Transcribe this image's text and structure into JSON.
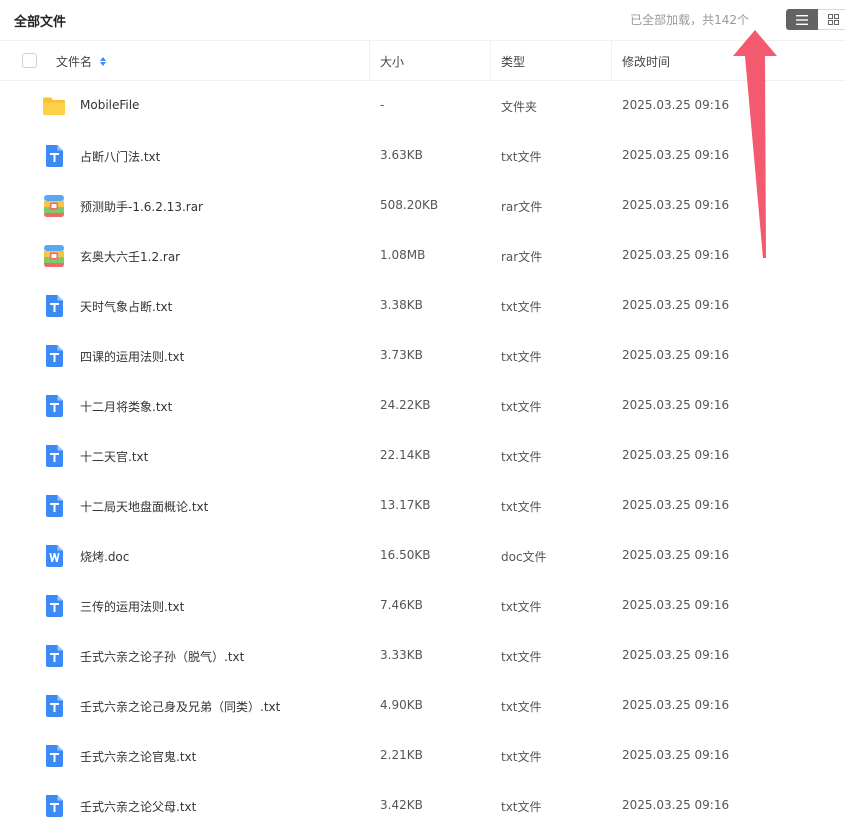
{
  "header": {
    "title": "全部文件",
    "load_status": "已全部加载，共142个"
  },
  "columns": {
    "name": "文件名",
    "size": "大小",
    "type": "类型",
    "modified": "修改时间"
  },
  "colors": {
    "accent": "#3b8af5",
    "folder": "#f9c12f",
    "annotation_arrow": "#f45a6e"
  },
  "files": [
    {
      "name": "MobileFile",
      "size": "-",
      "type": "文件夹",
      "modified": "2025.03.25 09:16",
      "icon": "folder-icon"
    },
    {
      "name": "占断八门法.txt",
      "size": "3.63KB",
      "type": "txt文件",
      "modified": "2025.03.25 09:16",
      "icon": "txt-file-icon"
    },
    {
      "name": "预测助手-1.6.2.13.rar",
      "size": "508.20KB",
      "type": "rar文件",
      "modified": "2025.03.25 09:16",
      "icon": "rar-file-icon"
    },
    {
      "name": "玄奥大六壬1.2.rar",
      "size": "1.08MB",
      "type": "rar文件",
      "modified": "2025.03.25 09:16",
      "icon": "rar-file-icon"
    },
    {
      "name": "天时气象占断.txt",
      "size": "3.38KB",
      "type": "txt文件",
      "modified": "2025.03.25 09:16",
      "icon": "txt-file-icon"
    },
    {
      "name": "四课的运用法则.txt",
      "size": "3.73KB",
      "type": "txt文件",
      "modified": "2025.03.25 09:16",
      "icon": "txt-file-icon"
    },
    {
      "name": "十二月将类象.txt",
      "size": "24.22KB",
      "type": "txt文件",
      "modified": "2025.03.25 09:16",
      "icon": "txt-file-icon"
    },
    {
      "name": "十二天官.txt",
      "size": "22.14KB",
      "type": "txt文件",
      "modified": "2025.03.25 09:16",
      "icon": "txt-file-icon"
    },
    {
      "name": "十二局天地盘面概论.txt",
      "size": "13.17KB",
      "type": "txt文件",
      "modified": "2025.03.25 09:16",
      "icon": "txt-file-icon"
    },
    {
      "name": "烧烤.doc",
      "size": "16.50KB",
      "type": "doc文件",
      "modified": "2025.03.25 09:16",
      "icon": "doc-file-icon"
    },
    {
      "name": "三传的运用法则.txt",
      "size": "7.46KB",
      "type": "txt文件",
      "modified": "2025.03.25 09:16",
      "icon": "txt-file-icon"
    },
    {
      "name": "壬式六亲之论子孙（脱气）.txt",
      "size": "3.33KB",
      "type": "txt文件",
      "modified": "2025.03.25 09:16",
      "icon": "txt-file-icon"
    },
    {
      "name": "壬式六亲之论己身及兄弟（同类）.txt",
      "size": "4.90KB",
      "type": "txt文件",
      "modified": "2025.03.25 09:16",
      "icon": "txt-file-icon"
    },
    {
      "name": "壬式六亲之论官鬼.txt",
      "size": "2.21KB",
      "type": "txt文件",
      "modified": "2025.03.25 09:16",
      "icon": "txt-file-icon"
    },
    {
      "name": "壬式六亲之论父母.txt",
      "size": "3.42KB",
      "type": "txt文件",
      "modified": "2025.03.25 09:16",
      "icon": "txt-file-icon"
    }
  ]
}
